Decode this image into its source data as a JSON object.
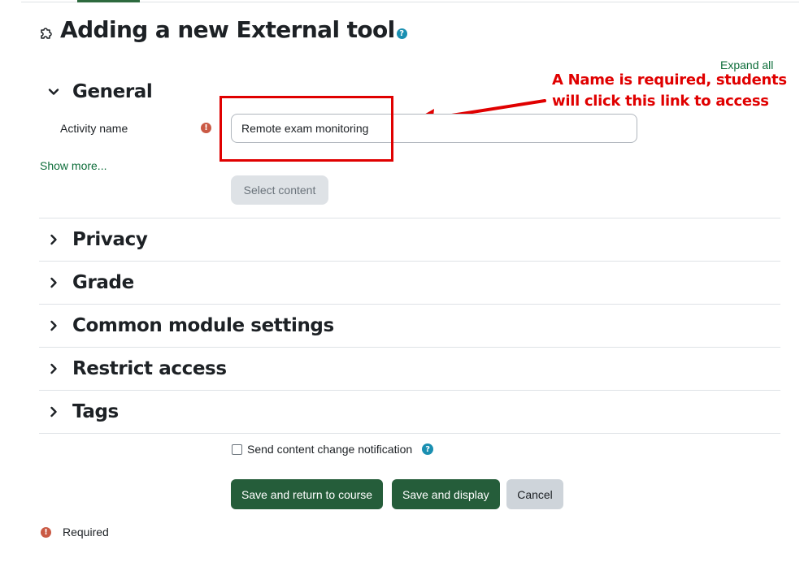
{
  "page": {
    "title": "Adding a new External tool",
    "title_icon": "puzzle-piece-icon",
    "help_icon": "question-circle-icon",
    "expand_all_label": "Expand all"
  },
  "annotation": {
    "line1": "A Name is required, students",
    "line2": "will click this link to access",
    "color": "#e00000"
  },
  "sections": [
    {
      "label": "General",
      "expanded": true
    },
    {
      "label": "Privacy",
      "expanded": false
    },
    {
      "label": "Grade",
      "expanded": false
    },
    {
      "label": "Common module settings",
      "expanded": false
    },
    {
      "label": "Restrict access",
      "expanded": false
    },
    {
      "label": "Tags",
      "expanded": false
    }
  ],
  "general": {
    "activity_name_label": "Activity name",
    "activity_name_value": "Remote exam monitoring",
    "required_icon": "exclamation-circle-icon",
    "show_more_label": "Show more...",
    "select_content_label": "Select content"
  },
  "notification": {
    "label": "Send content change notification",
    "checked": false
  },
  "buttons": {
    "save_return": "Save and return to course",
    "save_display": "Save and display",
    "cancel": "Cancel"
  },
  "legend": {
    "required_label": "Required"
  },
  "colors": {
    "primary_button": "#255d3a",
    "link": "#0f6e3b",
    "help": "#1a8fb1",
    "required": "#ca5a45",
    "secondary_button": "#ced4da"
  }
}
